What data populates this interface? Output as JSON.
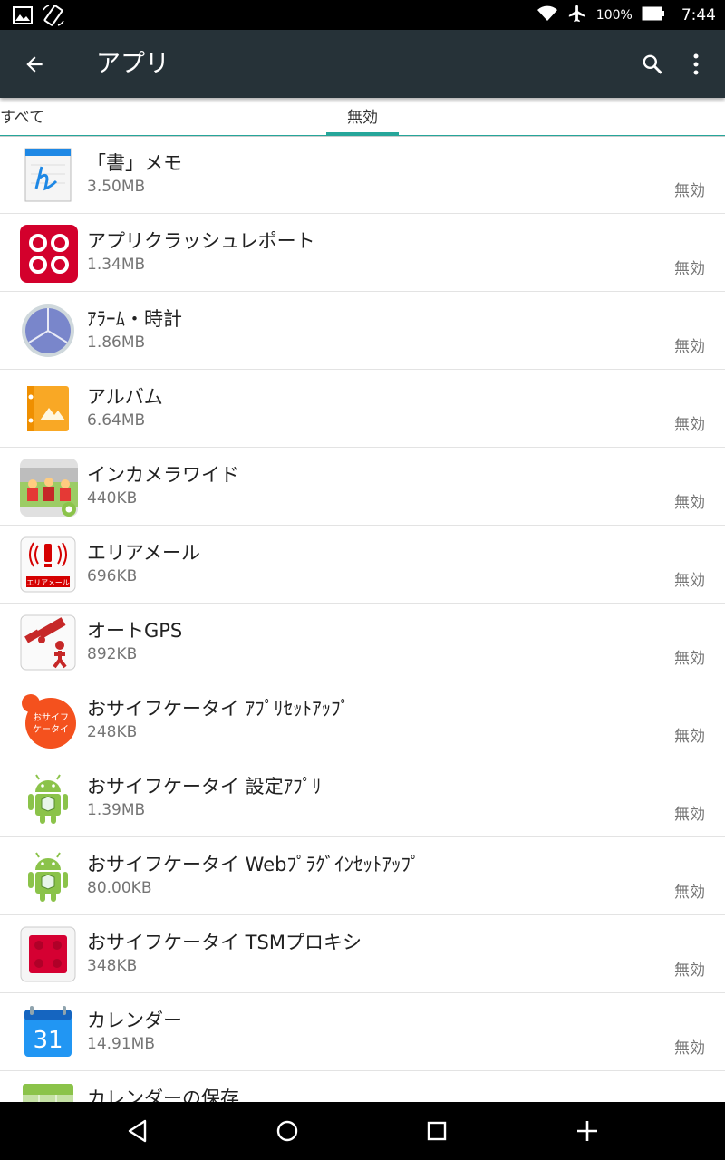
{
  "status_bar": {
    "icons_left": [
      "image-icon",
      "screen-rotation-icon"
    ],
    "icons_right": [
      "wifi-icon",
      "airplane-icon"
    ],
    "battery": "100%",
    "time": "7:44"
  },
  "action_bar": {
    "title": "アプリ",
    "background_color": "#263238"
  },
  "tabs": [
    {
      "label": "すべて",
      "selected": false
    },
    {
      "label": "無効",
      "selected": true
    }
  ],
  "accent_color": "#26a69a",
  "apps": [
    {
      "name": "「書」メモ",
      "size": "3.50MB",
      "status": "無効",
      "icon": "memo-icon"
    },
    {
      "name": "アプリクラッシュレポート",
      "size": "1.34MB",
      "status": "無効",
      "icon": "crash-report-icon"
    },
    {
      "name": "ｱﾗｰﾑ・時計",
      "size": "1.86MB",
      "status": "無効",
      "icon": "clock-icon"
    },
    {
      "name": "アルバム",
      "size": "6.64MB",
      "status": "無効",
      "icon": "album-icon"
    },
    {
      "name": "インカメラワイド",
      "size": "440KB",
      "status": "無効",
      "icon": "camera-wide-icon"
    },
    {
      "name": "エリアメール",
      "size": "696KB",
      "status": "無効",
      "icon": "area-mail-icon"
    },
    {
      "name": "オートGPS",
      "size": "892KB",
      "status": "無効",
      "icon": "auto-gps-icon"
    },
    {
      "name": "おサイフケータイ ｱﾌﾟﾘｾｯﾄｱｯﾌﾟ",
      "size": "248KB",
      "status": "無効",
      "icon": "osaifu-icon"
    },
    {
      "name": "おサイフケータイ 設定ｱﾌﾟﾘ",
      "size": "1.39MB",
      "status": "無効",
      "icon": "android-icon"
    },
    {
      "name": "おサイフケータイ Webﾌﾟﾗｸﾞｲﾝｾｯﾄｱｯﾌﾟ",
      "size": "80.00KB",
      "status": "無効",
      "icon": "android-icon"
    },
    {
      "name": "おサイフケータイ TSMプロキシ",
      "size": "348KB",
      "status": "無効",
      "icon": "tsm-proxy-icon"
    },
    {
      "name": "カレンダー",
      "size": "14.91MB",
      "status": "無効",
      "icon": "calendar-icon"
    },
    {
      "name": "カレンダーの保存",
      "size": "",
      "status": "",
      "icon": "calendar-storage-icon"
    }
  ],
  "icon_texts": {
    "calendar_day": "31",
    "osaifu_line1": "おサイフ",
    "osaifu_line2": "ケータイ",
    "area_mail_label": "エリアメール"
  },
  "nav_bar": [
    "back-icon",
    "home-icon",
    "recents-icon",
    "add-icon"
  ]
}
